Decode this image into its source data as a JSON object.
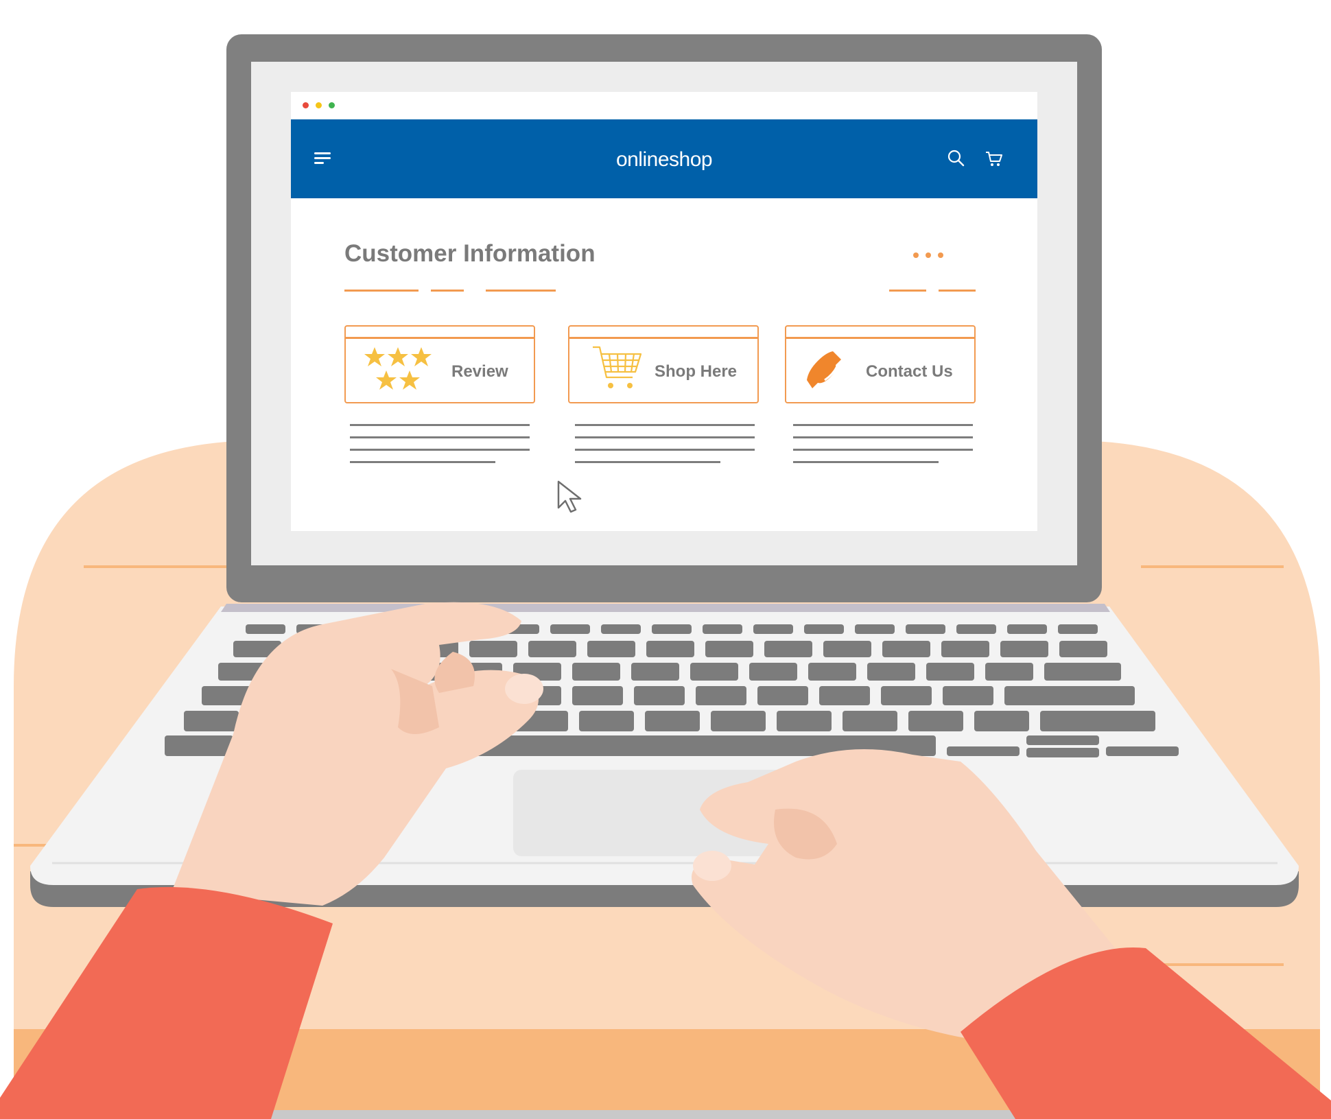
{
  "colors": {
    "brand_blue": "#0060a9",
    "accent_orange": "#f29a50",
    "star_yellow": "#f6c042",
    "text_gray": "#7a7a7a",
    "laptop_gray": "#808080",
    "desk_peach": "#fcd9bb",
    "sleeve_red": "#f26a55",
    "skin": "#f9d4bf"
  },
  "window": {
    "controls": [
      {
        "name": "close",
        "color": "#e84a3c"
      },
      {
        "name": "minimize",
        "color": "#f5c518"
      },
      {
        "name": "maximize",
        "color": "#3fb34f"
      }
    ]
  },
  "navbar": {
    "brand": "onlineshop",
    "menu_icon": "hamburger-menu-icon",
    "search_icon": "search-icon",
    "cart_icon": "cart-icon"
  },
  "page": {
    "title": "Customer Information",
    "more_icon": "more-dots-icon"
  },
  "cards": [
    {
      "label": "Review",
      "icon": "five-stars-icon"
    },
    {
      "label": "Shop Here",
      "icon": "shopping-cart-icon"
    },
    {
      "label": "Contact Us",
      "icon": "phone-icon"
    }
  ],
  "pointer": {
    "icon": "mouse-cursor-icon"
  }
}
